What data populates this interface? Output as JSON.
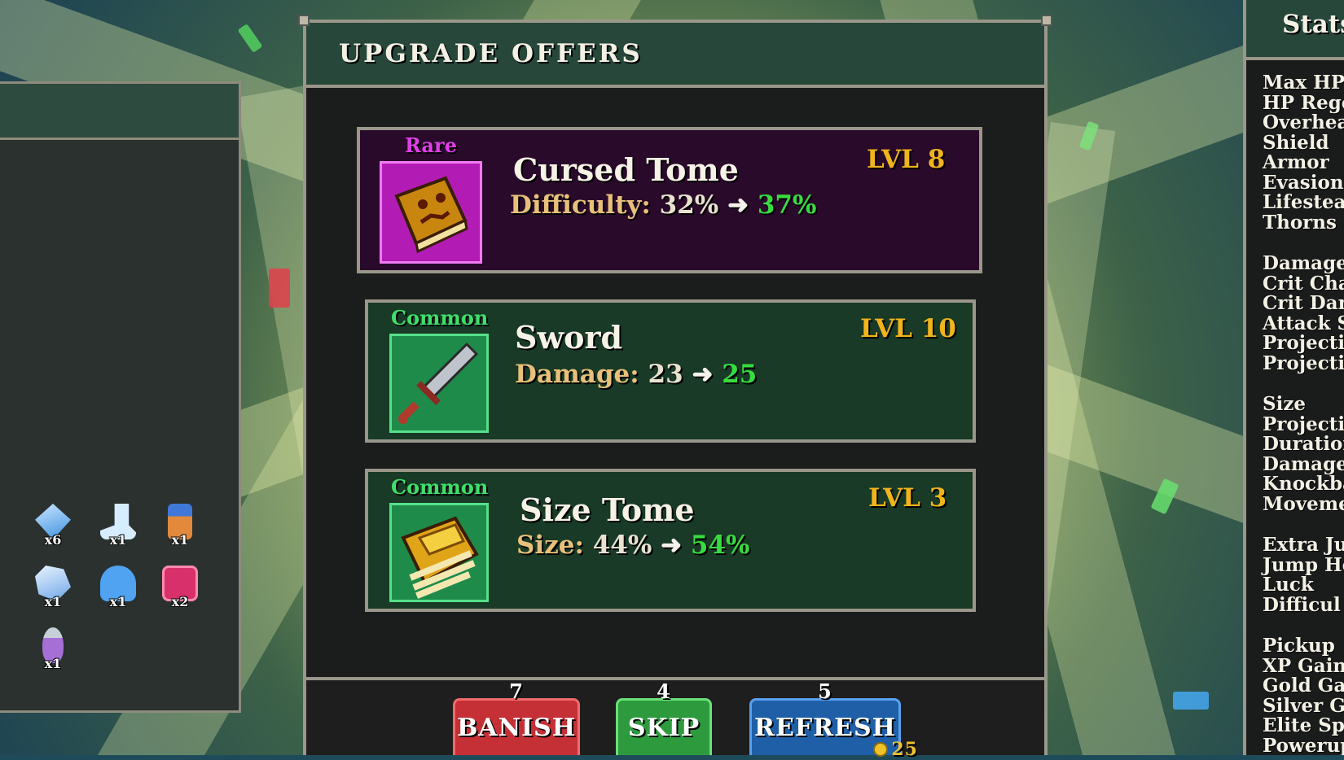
{
  "upgrade_panel": {
    "title": "UPGRADE OFFERS",
    "offers": [
      {
        "rarity": "Rare",
        "name": "Cursed Tome",
        "level": "LVL 8",
        "stat_label": "Difficulty:",
        "old_value": "32%",
        "new_value": "37%",
        "icon": "cursed-tome-icon"
      },
      {
        "rarity": "Common",
        "name": "Sword",
        "level": "LVL 10",
        "stat_label": "Damage:",
        "old_value": "23",
        "new_value": "25",
        "icon": "sword-icon"
      },
      {
        "rarity": "Common",
        "name": "Size Tome",
        "level": "LVL 3",
        "stat_label": "Size:",
        "old_value": "44%",
        "new_value": "54%",
        "icon": "size-tome-icon"
      }
    ],
    "buttons": {
      "banish": {
        "label": "BANISH",
        "count": "7"
      },
      "skip": {
        "label": "SKIP",
        "count": "4"
      },
      "refresh": {
        "label": "REFRESH",
        "count": "5",
        "cost": "25"
      }
    }
  },
  "inventory": {
    "items": [
      {
        "icon": "crystal-shard-icon",
        "count": "x6"
      },
      {
        "icon": "boot-icon",
        "count": "x1"
      },
      {
        "icon": "battery-icon",
        "count": "x1"
      },
      {
        "icon": "ice-crystal-icon",
        "count": "x1"
      },
      {
        "icon": "ghost-icon",
        "count": "x1"
      },
      {
        "icon": "demon-mask-icon",
        "count": "x2"
      },
      {
        "icon": "potion-icon",
        "count": "x1"
      }
    ]
  },
  "stats_panel": {
    "title": "Stats",
    "groups": [
      [
        "Max HP",
        "HP Rege",
        "Overhea",
        "Shield",
        "Armor",
        "Evasion",
        "Lifestea",
        "Thorns"
      ],
      [
        "Damage",
        "Crit Cha",
        "Crit Dan",
        "Attack S",
        "Projectil",
        "Projectil"
      ],
      [
        "Size",
        "Projectil",
        "Duration",
        "Damage",
        "Knockba",
        "Moveme"
      ],
      [
        "Extra Ju",
        "Jump He",
        "Luck",
        "Difficul"
      ],
      [
        "Pickup",
        "XP Gain",
        "Gold Gai",
        "Silver G",
        "Elite Sp",
        "Powerup"
      ]
    ]
  },
  "colors": {
    "rare": "#e040e8",
    "common": "#3fe06a",
    "level": "#f0b51c",
    "stat_new": "#37dd3f",
    "banish": "#c53036",
    "skip": "#2d9a3e",
    "refresh": "#1f5fa8"
  }
}
